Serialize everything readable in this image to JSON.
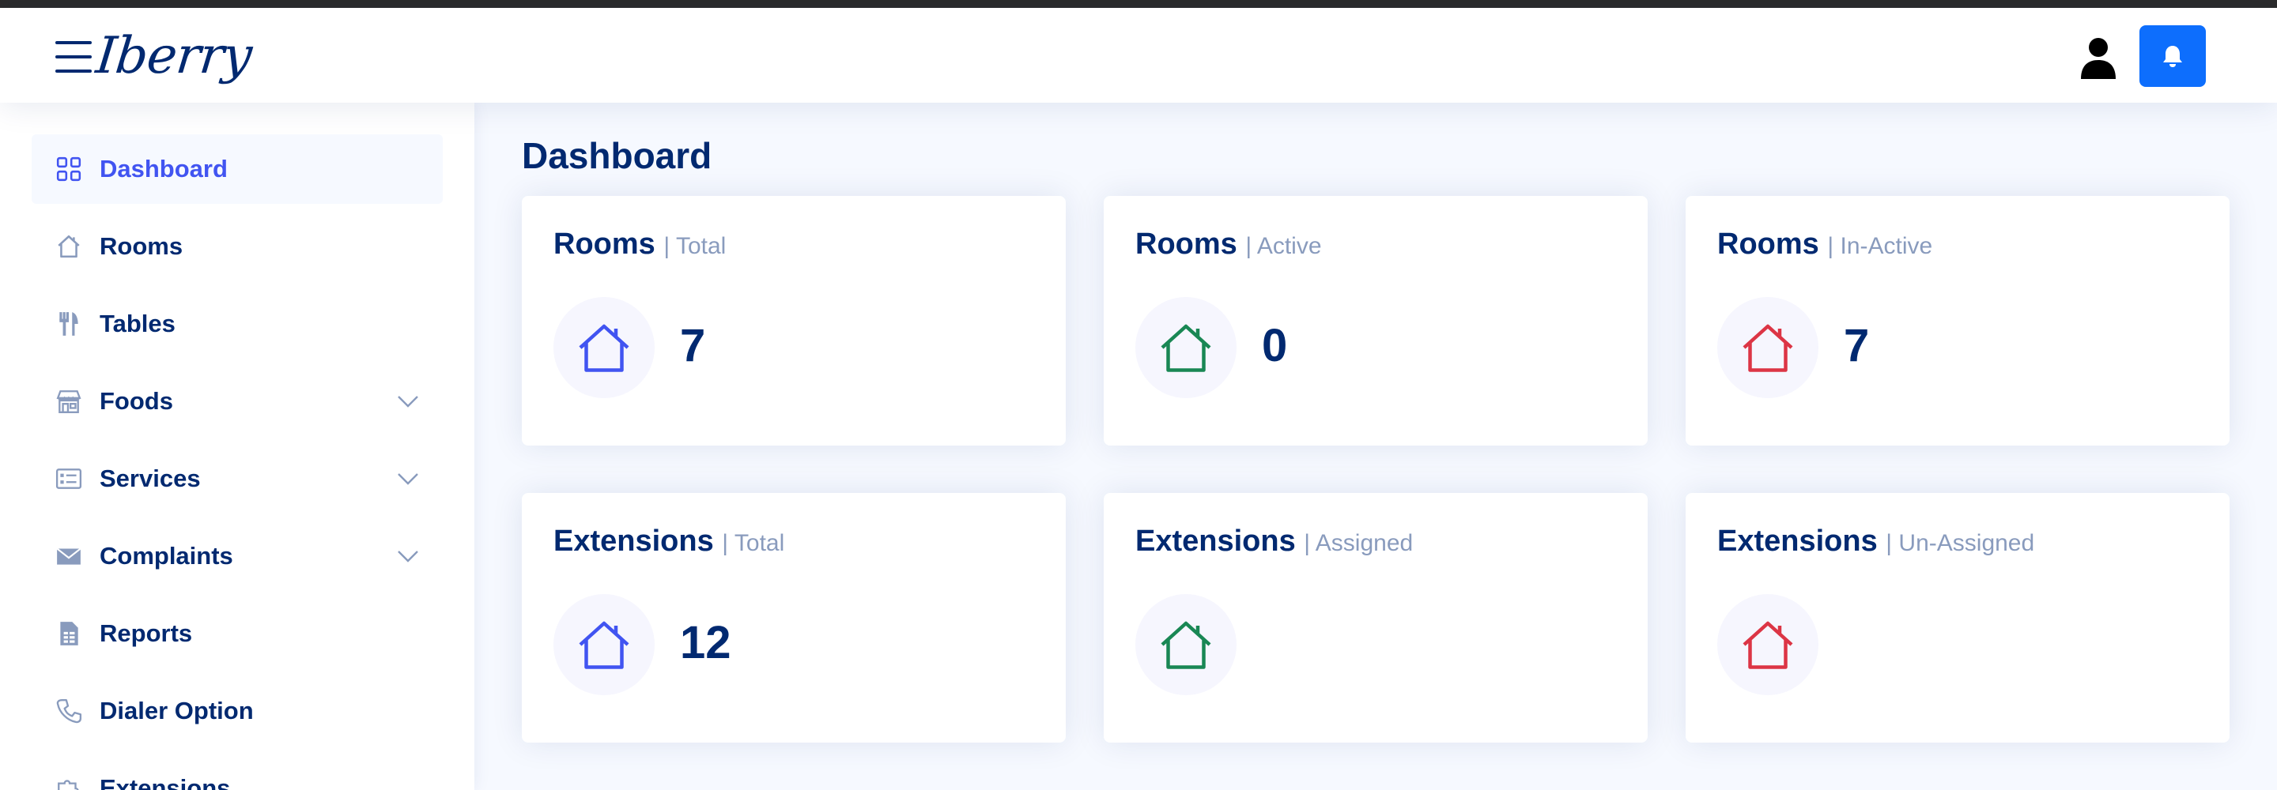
{
  "app": {
    "logo": "Iberry"
  },
  "header": {
    "user_icon": "person-icon",
    "notification_icon": "bell-icon",
    "notification_color": "#0d6efd"
  },
  "sidebar": {
    "items": [
      {
        "label": "Dashboard",
        "icon": "grid-icon",
        "active": true,
        "expandable": false
      },
      {
        "label": "Rooms",
        "icon": "house-icon",
        "active": false,
        "expandable": false
      },
      {
        "label": "Tables",
        "icon": "fork-knife-icon",
        "active": false,
        "expandable": false
      },
      {
        "label": "Foods",
        "icon": "shop-icon",
        "active": false,
        "expandable": true
      },
      {
        "label": "Services",
        "icon": "card-list-icon",
        "active": false,
        "expandable": true
      },
      {
        "label": "Complaints",
        "icon": "envelope-icon",
        "active": false,
        "expandable": true
      },
      {
        "label": "Reports",
        "icon": "spreadsheet-icon",
        "active": false,
        "expandable": false
      },
      {
        "label": "Dialer Option",
        "icon": "telephone-icon",
        "active": false,
        "expandable": false
      },
      {
        "label": "Extensions",
        "icon": "puzzle-icon",
        "active": false,
        "expandable": false
      }
    ]
  },
  "main": {
    "title": "Dashboard",
    "cards": [
      {
        "title": "Rooms",
        "subtitle": "| Total",
        "value": "7",
        "icon_color": "#4154f1"
      },
      {
        "title": "Rooms",
        "subtitle": "| Active",
        "value": "0",
        "icon_color": "#2eca6a"
      },
      {
        "title": "Rooms",
        "subtitle": "| In-Active",
        "value": "7",
        "icon_color": "#ff771d"
      },
      {
        "title": "Extensions",
        "subtitle": "| Total",
        "value": "12",
        "icon_color": "#4154f1"
      },
      {
        "title": "Extensions",
        "subtitle": "| Assigned",
        "value": "",
        "icon_color": "#2eca6a"
      },
      {
        "title": "Extensions",
        "subtitle": "| Un-Assigned",
        "value": "",
        "icon_color": "#ff771d"
      }
    ]
  },
  "colors": {
    "accent": "#4154f1",
    "text": "#012970",
    "muted": "#899bbd",
    "green": "#198754",
    "red": "#dc3545",
    "background": "#f6f9ff"
  }
}
